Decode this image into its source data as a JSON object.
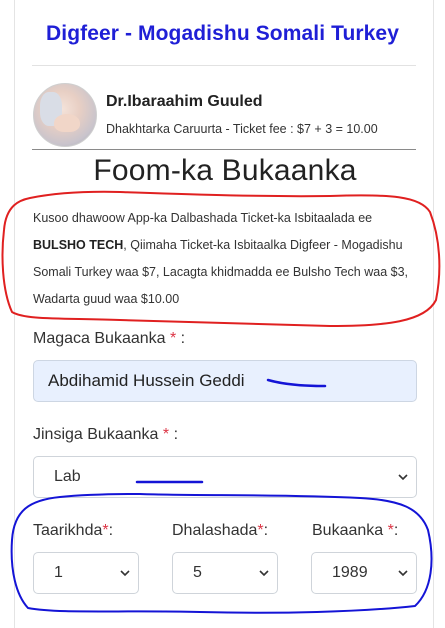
{
  "header": {
    "site_title": "Digfeer - Mogadishu Somali Turkey"
  },
  "doctor": {
    "name": "Dr.Ibaraahim Guuled",
    "details": "Dhakhtarka Caruurta - Ticket fee : $7 + 3 = 10.00"
  },
  "form": {
    "title": "Foom-ka Bukaanka",
    "info_part1": "Kusoo dhawoow App-ka Dalbashada Ticket-ka Isbitaalada ee ",
    "info_bold": "BULSHO TECH",
    "info_part2": ", Qiimaha Ticket-ka Isbitaalka Digfeer - Mogadishu Somali Turkey waa $7, Lacagta khidmadda ee Bulsho Tech waa $3, Wadarta guud waa $10.00",
    "patient_name_label": "Magaca Bukaanka",
    "patient_name_value": "Abdihamid Hussein Geddi",
    "gender_label": "Jinsiga Bukaanka",
    "gender_value": "Lab",
    "date_label": "Taarikhda",
    "date_value": "1",
    "month_label": "Dhalashada",
    "month_value": "5",
    "year_label": "Bukaanka",
    "year_value": "1989",
    "required_mark": "*",
    "label_colon": ":"
  },
  "annotation_colors": {
    "red_ink": "#e02020",
    "blue_ink": "#1414d6"
  }
}
